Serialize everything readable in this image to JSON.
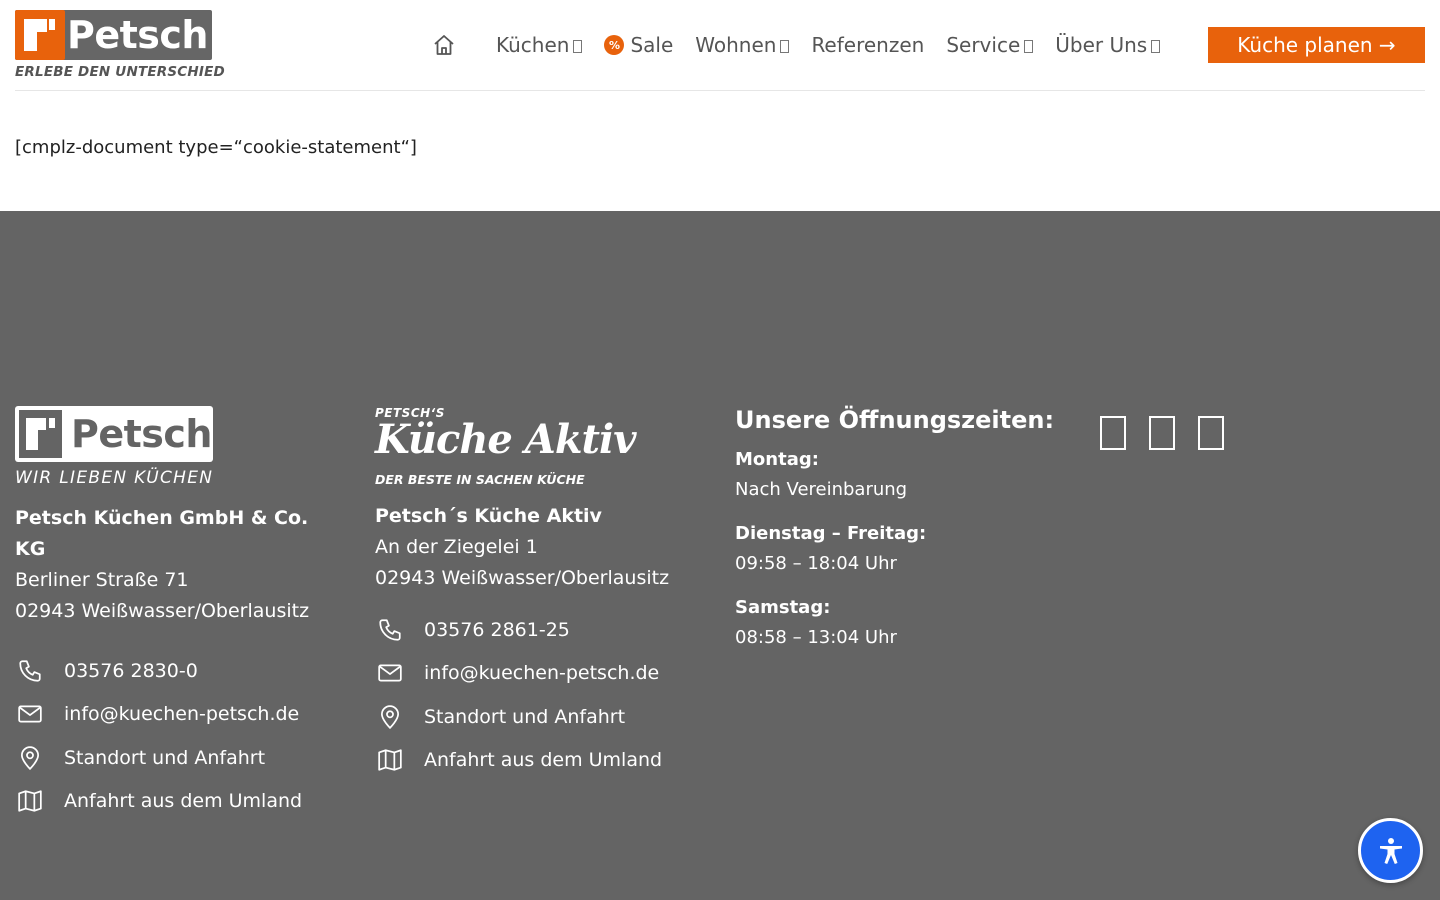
{
  "header": {
    "logo": {
      "name": "Petsch",
      "tagline": "ERLEBE DEN UNTERSCHIED",
      "brand_color": "#e8620c",
      "box_color": "#666666"
    },
    "home_icon": "home-icon",
    "nav": {
      "kuechen": "Küchen",
      "sale": "Sale",
      "sale_badge": "%",
      "wohnen": "Wohnen",
      "referenzen": "Referenzen",
      "service": "Service",
      "ueber_uns": "Über Uns"
    },
    "cta_label": "Küche planen →"
  },
  "main": {
    "shortcode": "[cmplz-document type=“cookie-statement“]"
  },
  "footer": {
    "background": "#646464",
    "col1": {
      "logo_name": "Petsch",
      "logo_tagline": "WIR LIEBEN KÜCHEN",
      "company": "Petsch Küchen GmbH & Co. KG",
      "street": "Berliner Straße 71",
      "city": "02943 Weißwasser/Oberlausitz",
      "phone": "03576 2830-0",
      "email": "info@kuechen-petsch.de",
      "location": "Standort und Anfahrt",
      "directions": "Anfahrt aus dem Umland"
    },
    "col2": {
      "logo_top": "PETSCH‘S",
      "logo_script": "Küche Aktiv",
      "logo_bottom": "DER BESTE IN SACHEN KÜCHE",
      "company": "Petsch´s Küche Aktiv",
      "street": "An der Ziegelei 1",
      "city": "02943 Weißwasser/Oberlausitz",
      "phone": "03576 2861-25",
      "email": "info@kuechen-petsch.de",
      "location": "Standort und Anfahrt",
      "directions": "Anfahrt aus dem Umland"
    },
    "hours": {
      "title": "Unsere Öffnungszeiten:",
      "monday_label": "Montag:",
      "monday_time": "Nach Vereinbarung",
      "weekday_label": "Dienstag – Freitag:",
      "weekday_time": "09:58 – 18:04 Uhr",
      "saturday_label": "Samstag:",
      "saturday_time": "08:58 – 13:04 Uhr"
    },
    "social_icons": [
      "facebook-icon",
      "instagram-icon",
      "youtube-icon"
    ]
  },
  "accessibility_button": {
    "icon": "accessibility-icon",
    "color": "#1e63f0"
  }
}
